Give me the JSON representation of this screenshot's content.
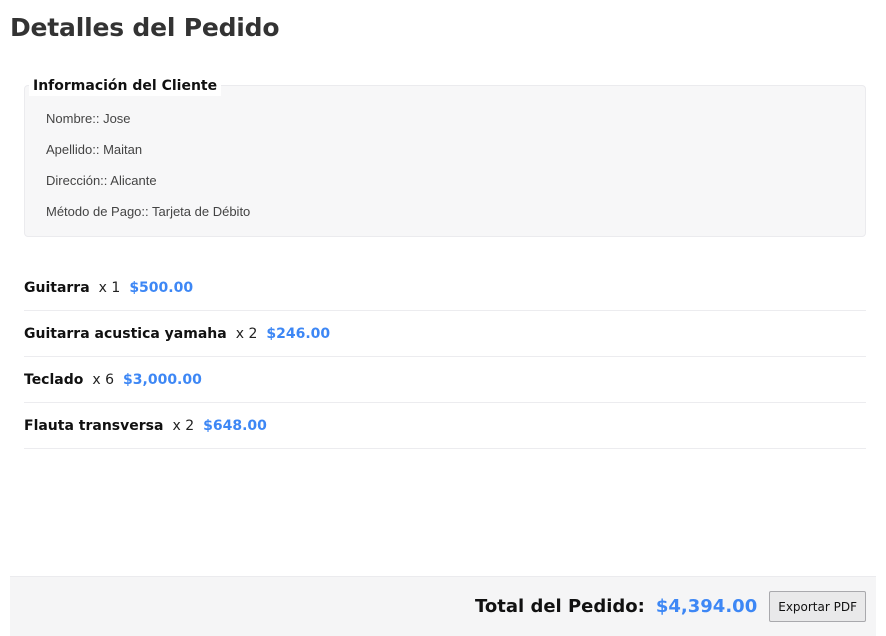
{
  "page": {
    "title": "Detalles del Pedido"
  },
  "customer": {
    "legend": "Información del Cliente",
    "fields": [
      {
        "label": "Nombre:",
        "value": "Jose"
      },
      {
        "label": "Apellido:",
        "value": "Maitan"
      },
      {
        "label": "Dirección:",
        "value": "Alicante"
      },
      {
        "label": "Método de Pago:",
        "value": "Tarjeta de Débito"
      }
    ],
    "lines": [
      "Nombre:: Jose",
      "Apellido:: Maitan",
      "Dirección:: Alicante",
      "Método de Pago:: Tarjeta de Débito"
    ]
  },
  "items": [
    {
      "name": "Guitarra",
      "qty": "x 1",
      "price": "$500.00"
    },
    {
      "name": "Guitarra acustica yamaha",
      "qty": "x 2",
      "price": "$246.00"
    },
    {
      "name": "Teclado",
      "qty": "x 6",
      "price": "$3,000.00"
    },
    {
      "name": "Flauta transversa",
      "qty": "x 2",
      "price": "$648.00"
    }
  ],
  "footer": {
    "total_label": "Total del Pedido:",
    "total_value": "$4,394.00",
    "export_label": "Exportar PDF"
  },
  "colors": {
    "accent": "#3d87f5",
    "panel_bg": "#f7f7f8",
    "footer_bg": "#f5f5f6"
  }
}
